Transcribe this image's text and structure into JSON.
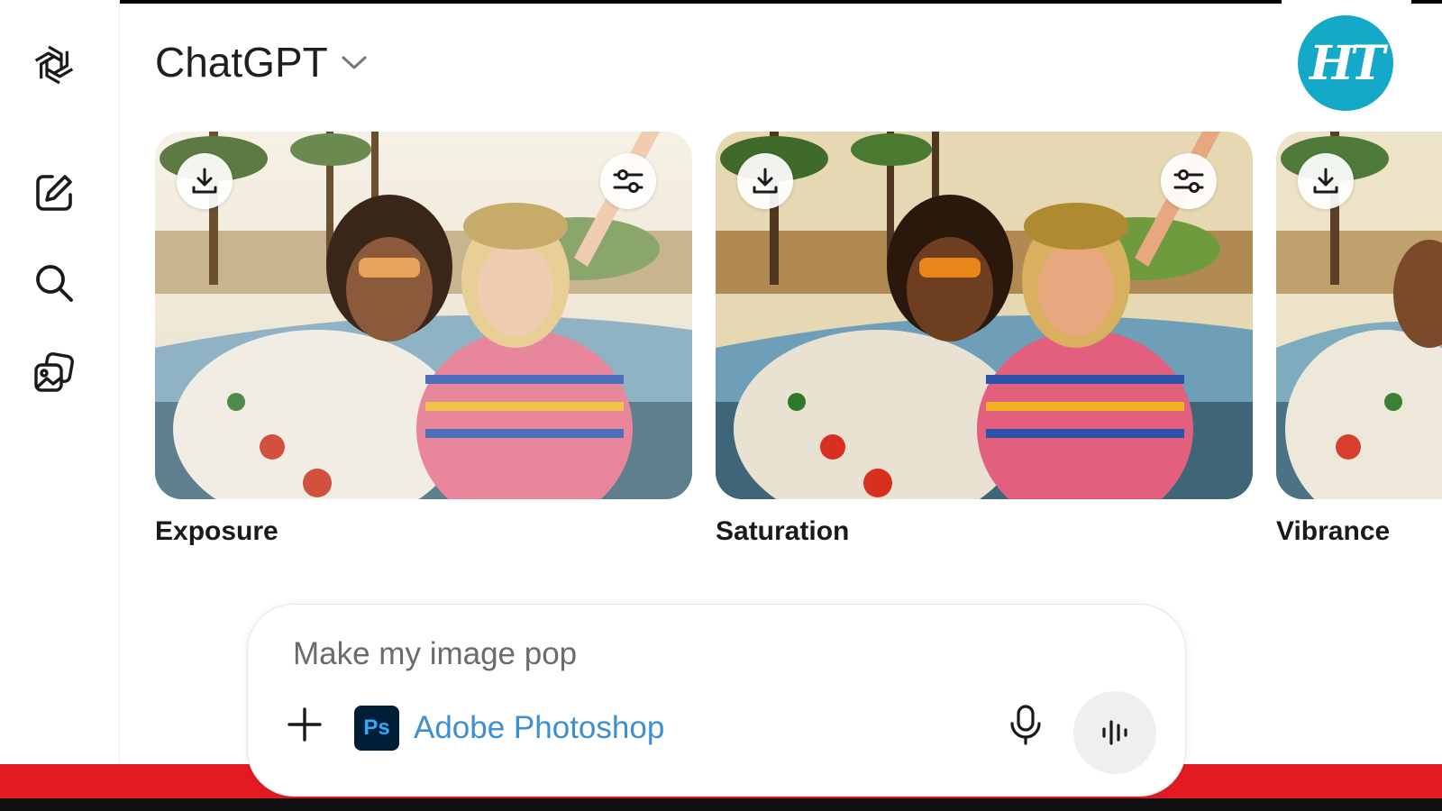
{
  "header": {
    "title": "ChatGPT",
    "dropdown_icon": "chevron-down-icon"
  },
  "watermark": {
    "text": "HT",
    "color": "#14a9c8"
  },
  "sidebar": {
    "icons": [
      "openai-logo-icon",
      "new-chat-icon",
      "search-icon",
      "library-icon"
    ]
  },
  "cards": [
    {
      "label": "Exposure",
      "download_icon": "download-icon",
      "adjust_icon": "sliders-icon"
    },
    {
      "label": "Saturation",
      "download_icon": "download-icon",
      "adjust_icon": "sliders-icon"
    },
    {
      "label": "Vibrance",
      "download_icon": "download-icon"
    }
  ],
  "composer": {
    "placeholder": "Make my image pop",
    "app_badge": "Ps",
    "app_name": "Adobe Photoshop",
    "icons": [
      "plus-icon",
      "microphone-icon",
      "voice-mode-icon"
    ]
  },
  "colors": {
    "accent_link": "#3d8fd1",
    "band_red": "#e31b23",
    "ps_bg": "#001e36",
    "ps_text": "#31a8ff"
  }
}
